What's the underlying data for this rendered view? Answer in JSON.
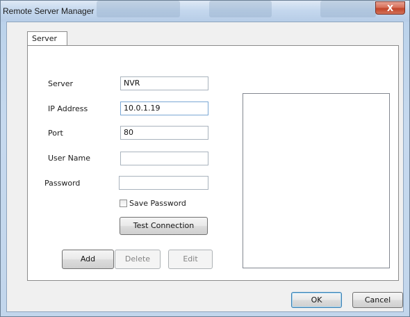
{
  "window": {
    "title": "Remote Server Manager",
    "close_glyph": "X"
  },
  "tabs": [
    {
      "label": "Server"
    }
  ],
  "form": {
    "server": {
      "label": "Server",
      "value": "NVR"
    },
    "ip_address": {
      "label": "IP Address",
      "value": "10.0.1.19"
    },
    "port": {
      "label": "Port",
      "value": "80"
    },
    "user_name": {
      "label": "User Name",
      "value": ""
    },
    "password": {
      "label": "Password",
      "value": ""
    },
    "save_password": {
      "label": "Save Password",
      "checked": false
    },
    "test_connection_label": "Test Connection"
  },
  "server_list": {
    "items": []
  },
  "actions": {
    "add_label": "Add",
    "delete_label": "Delete",
    "delete_enabled": false,
    "edit_label": "Edit",
    "edit_enabled": false
  },
  "footer": {
    "ok_label": "OK",
    "cancel_label": "Cancel"
  },
  "colors": {
    "title_bar": "#c5d8ee",
    "client_background": "#f0f0f0",
    "close_button": "#c2452b",
    "focus_border": "#7aa7d4"
  },
  "icons": {
    "close": "close-icon",
    "checkbox": "checkbox-icon"
  }
}
